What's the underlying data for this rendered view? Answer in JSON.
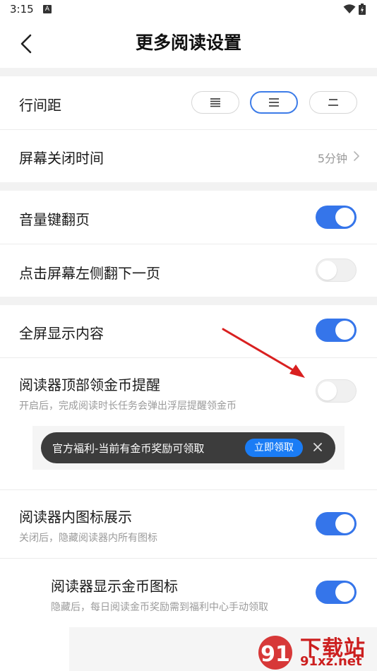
{
  "status_bar": {
    "time": "3:15",
    "app_badge": "A"
  },
  "header": {
    "title": "更多阅读设置"
  },
  "line_spacing": {
    "label": "行间距",
    "options": [
      "≡",
      "☰",
      "="
    ],
    "selected_index": 1
  },
  "screen_off": {
    "label": "屏幕关闭时间",
    "value": "5分钟"
  },
  "volume_page": {
    "label": "音量键翻页",
    "enabled": true
  },
  "tap_left": {
    "label": "点击屏幕左侧翻下一页",
    "enabled": false
  },
  "fullscreen": {
    "label": "全屏显示内容",
    "enabled": true
  },
  "coin_reminder": {
    "label": "阅读器顶部领金币提醒",
    "description": "开启后，完成阅读时长任务会弹出浮层提醒领金币",
    "enabled": false
  },
  "banner": {
    "text": "官方福利-当前有金币奖励可领取",
    "button": "立即领取"
  },
  "icon_display": {
    "label": "阅读器内图标展示",
    "description": "关闭后，隐藏阅读器内所有图标",
    "enabled": true
  },
  "coin_icon": {
    "label": "阅读器显示金币图标",
    "description": "隐藏后，每日阅读金币奖励需到福利中心手动领取",
    "enabled": true
  },
  "watermark": {
    "brand": "下载站",
    "domain": "91xz.net"
  },
  "colors": {
    "accent": "#3575ea",
    "annotation_arrow": "#d92020"
  }
}
